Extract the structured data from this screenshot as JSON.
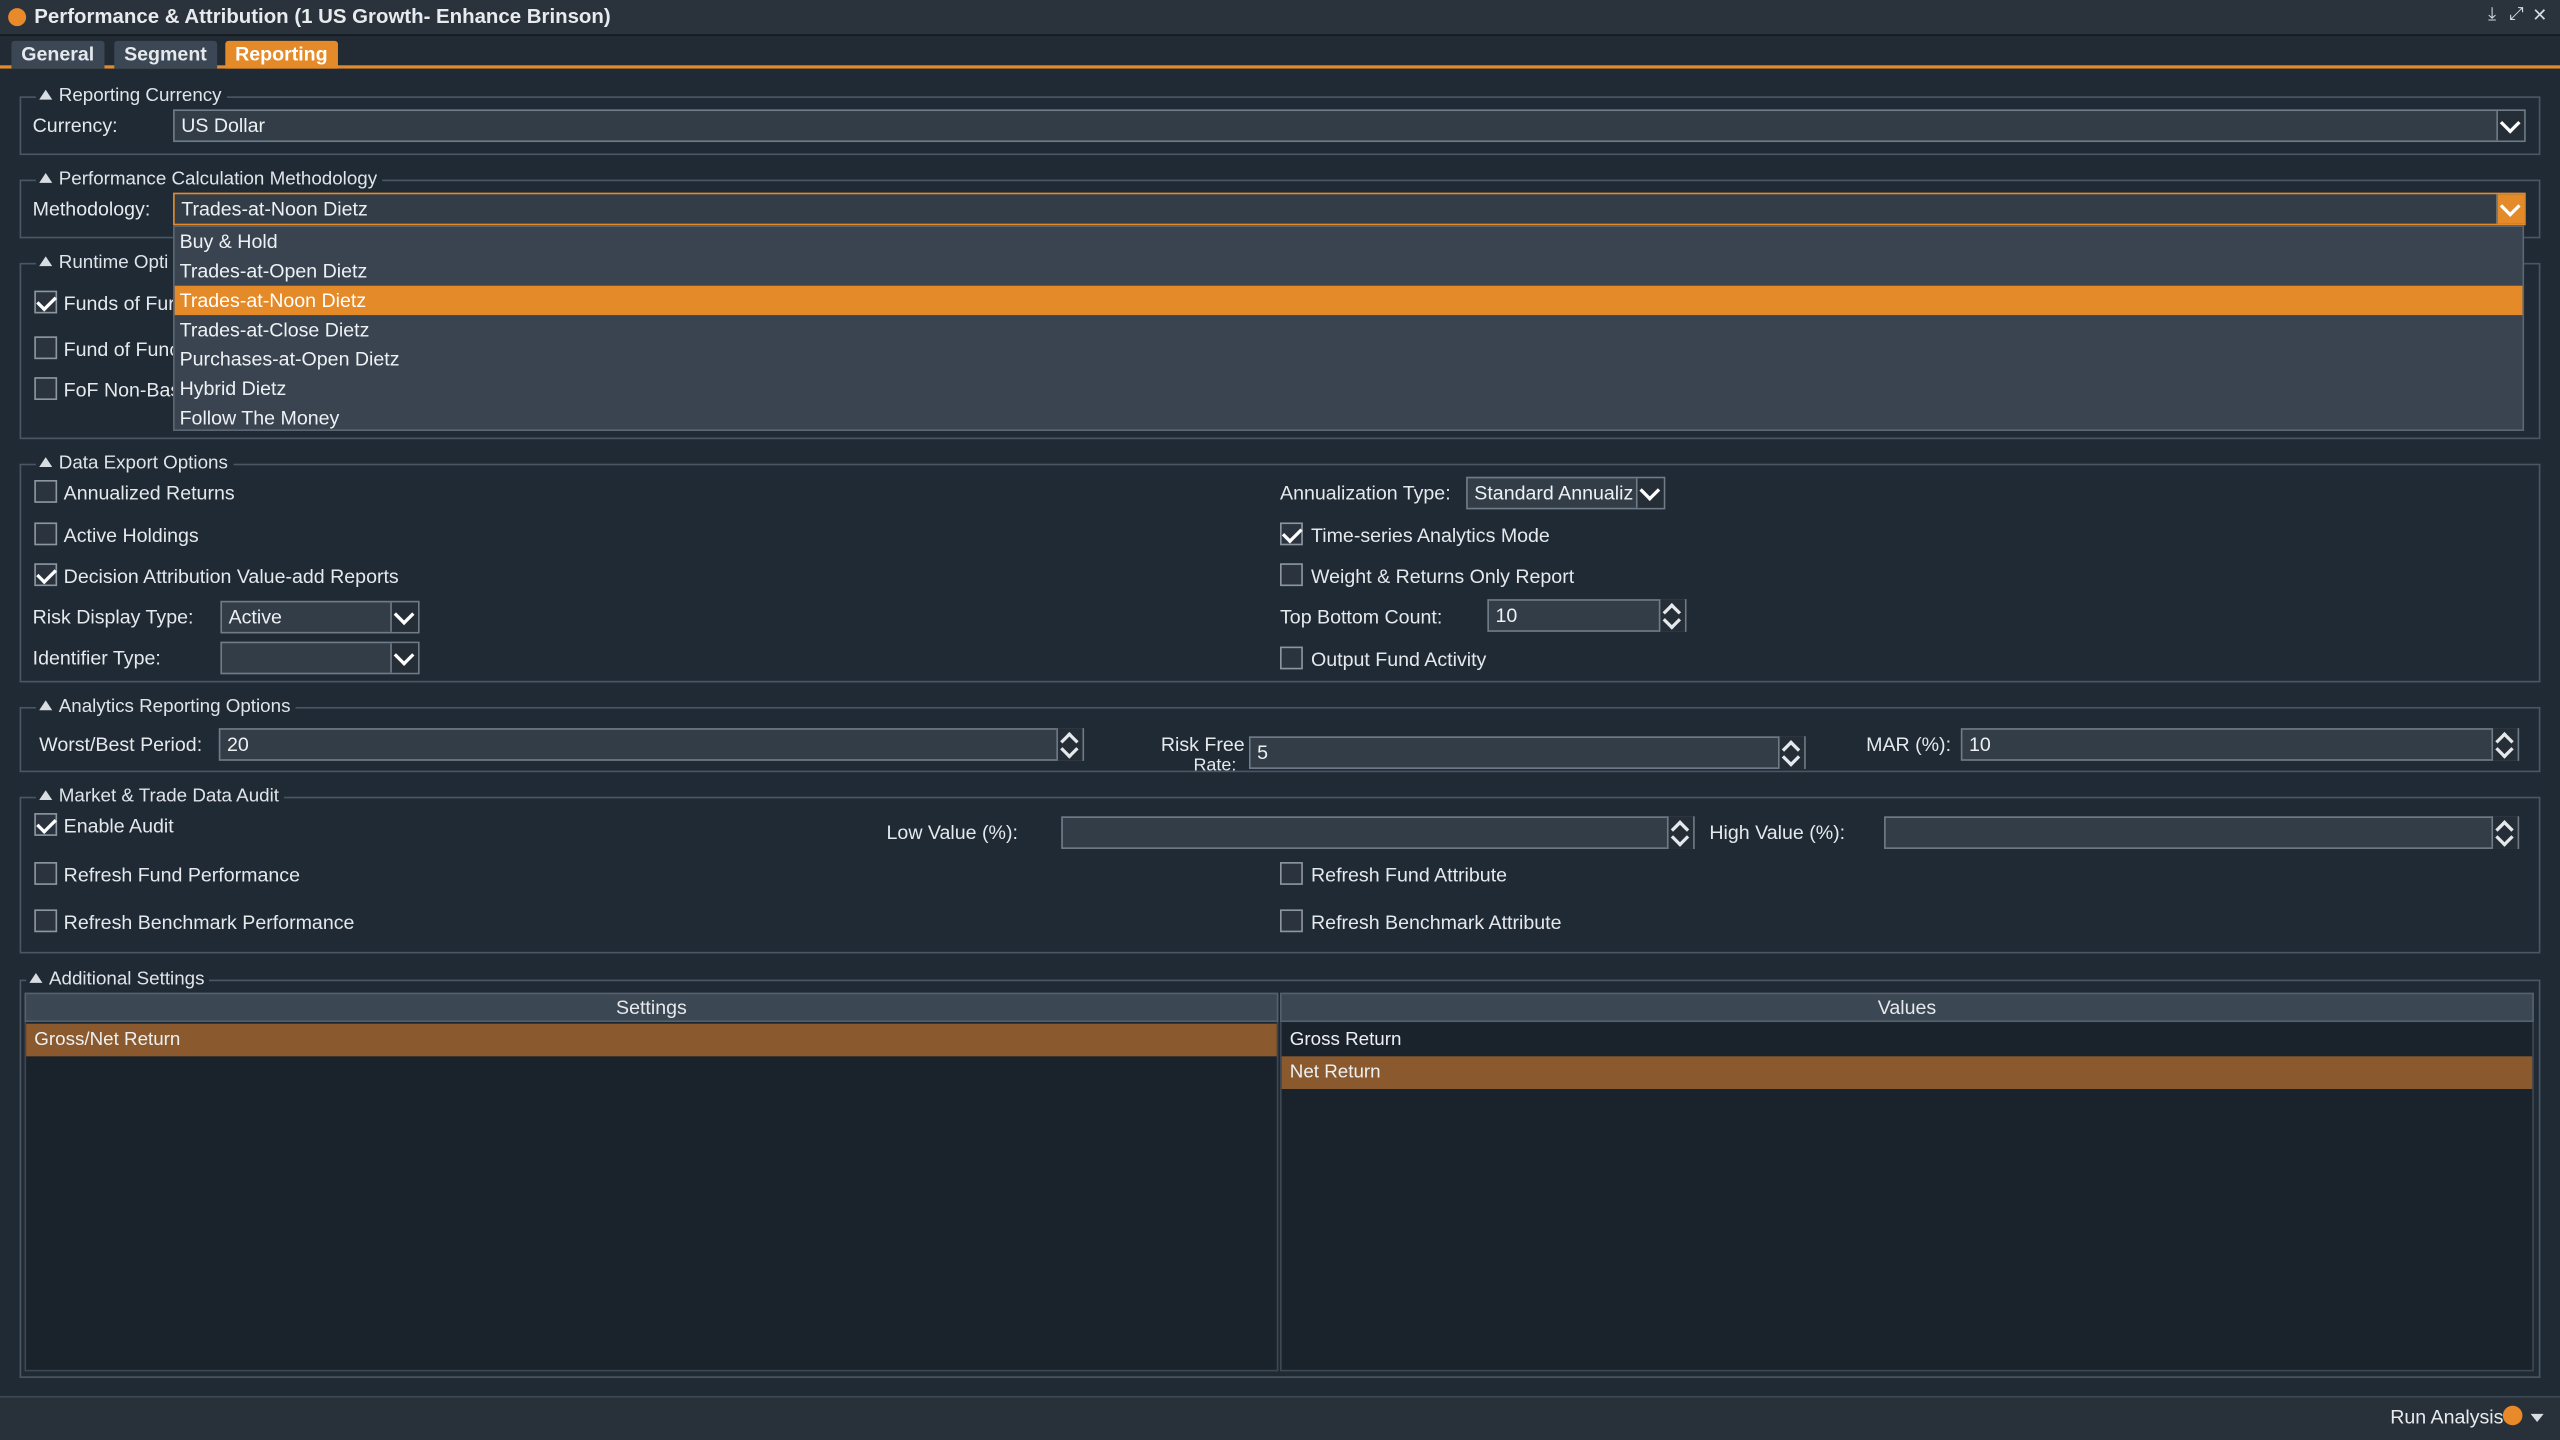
{
  "window": {
    "title": "Performance & Attribution (1 US Growth- Enhance Brinson)",
    "controls": [
      "⤓",
      "⤢",
      "✕"
    ]
  },
  "tabs": [
    {
      "label": "General"
    },
    {
      "label": "Segment"
    },
    {
      "label": "Reporting"
    }
  ],
  "reporting_currency": {
    "legend": "Reporting Currency",
    "currency_label": "Currency:",
    "currency_value": "US Dollar"
  },
  "methodology": {
    "legend": "Performance Calculation Methodology",
    "label": "Methodology:",
    "value": "Trades-at-Noon Dietz",
    "options": [
      "Buy & Hold",
      "Trades-at-Open Dietz",
      "Trades-at-Noon Dietz",
      "Trades-at-Close Dietz",
      "Purchases-at-Open Dietz",
      "Hybrid Dietz",
      "Follow The Money"
    ],
    "selected_index": 2
  },
  "runtime": {
    "legend": "Runtime Opti",
    "items": [
      {
        "label": "Funds of Fur",
        "checked": true
      },
      {
        "label": "Fund of Func",
        "checked": false
      },
      {
        "label": "FoF Non-Bas",
        "checked": false
      }
    ]
  },
  "data_export": {
    "legend": "Data Export Options",
    "annualized_returns": "Annualized Returns",
    "active_holdings": "Active Holdings",
    "decision_attribution": "Decision Attribution Value-add Reports",
    "risk_display_label": "Risk Display Type:",
    "risk_display_value": "Active",
    "identifier_label": "Identifier Type:",
    "identifier_value": "",
    "annualization_label": "Annualization Type:",
    "annualization_value": "Standard Annualiz",
    "time_series": "Time-series Analytics Mode",
    "weight_returns": "Weight & Returns Only Report",
    "top_bottom_label": "Top Bottom Count:",
    "top_bottom_value": "10",
    "output_fund_activity": "Output Fund Activity"
  },
  "analytics": {
    "legend": "Analytics Reporting Options",
    "worst_best_label": "Worst/Best Period:",
    "worst_best_value": "20",
    "risk_free_label_1": "Risk Free",
    "risk_free_label_2": "Rate:",
    "risk_free_value": "5",
    "mar_label": "MAR (%):",
    "mar_value": "10"
  },
  "audit": {
    "legend": "Market & Trade Data Audit",
    "enable_audit": "Enable Audit",
    "low_value_label": "Low Value (%):",
    "low_value": "",
    "high_value_label": "High Value (%):",
    "high_value": "",
    "refresh_fund_perf": "Refresh Fund Performance",
    "refresh_bench_perf": "Refresh Benchmark Performance",
    "refresh_fund_attr": "Refresh Fund Attribute",
    "refresh_bench_attr": "Refresh Benchmark Attribute"
  },
  "additional": {
    "legend": "Additional Settings",
    "col_settings": "Settings",
    "col_values": "Values",
    "settings_rows": [
      "Gross/Net Return"
    ],
    "values_rows": [
      "Gross Return",
      "Net Return"
    ]
  },
  "status": {
    "run_label": "Run Analysis"
  },
  "colors": {
    "accent": "#e58a28",
    "background": "#1f2a35",
    "selected_row": "#8a5a2e"
  }
}
